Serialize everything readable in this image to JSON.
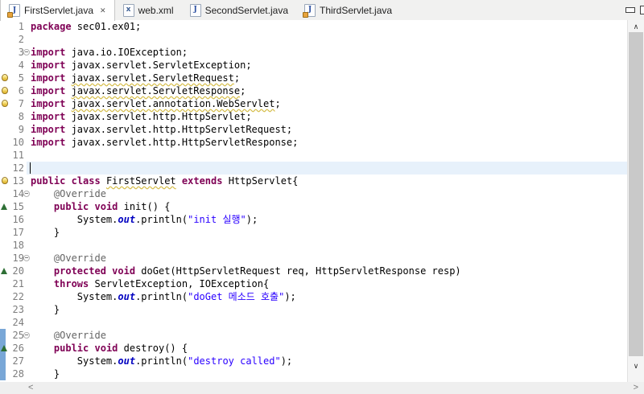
{
  "tabs": [
    {
      "label": "FirstServlet.java",
      "type": "java",
      "icon_letter": "J",
      "active": true,
      "closable": true,
      "warning_decorator": true
    },
    {
      "label": "web.xml",
      "type": "xml",
      "icon_letter": "x",
      "active": false,
      "closable": false,
      "warning_decorator": false
    },
    {
      "label": "SecondServlet.java",
      "type": "java",
      "icon_letter": "J",
      "active": false,
      "closable": false,
      "warning_decorator": false
    },
    {
      "label": "ThirdServlet.java",
      "type": "java",
      "icon_letter": "J",
      "active": false,
      "closable": false,
      "warning_decorator": true
    }
  ],
  "window_controls": [
    "minimize",
    "maximize"
  ],
  "icons": {
    "close": "✕",
    "scroll_up": "∧",
    "scroll_down": "∨",
    "scroll_left": "<",
    "scroll_right": ">"
  },
  "colors": {
    "keyword": "#7f0055",
    "string": "#2a00ff",
    "static_field": "#0000c0",
    "annotation": "#646464",
    "line_number": "#7d7d7d",
    "cursor_line_bg": "#e7f1fb",
    "diff_change_bar": "#79a7d7",
    "override_indicator": "#2e6f35",
    "warning_underline": "#d6be4b",
    "tab_bar_bg": "#f1f1f0",
    "active_tab_bg": "#ffffff"
  },
  "editor": {
    "lines": [
      {
        "num": 1,
        "tokens": [
          {
            "t": "package",
            "c": "kw"
          },
          {
            "t": " sec01.ex01;",
            "c": "pl"
          }
        ]
      },
      {
        "num": 2,
        "tokens": []
      },
      {
        "num": 3,
        "fold": true,
        "tokens": [
          {
            "t": "import",
            "c": "kw"
          },
          {
            "t": " java.io.IOException;",
            "c": "pl"
          }
        ]
      },
      {
        "num": 4,
        "tokens": [
          {
            "t": "import",
            "c": "kw"
          },
          {
            "t": " javax.servlet.ServletException;",
            "c": "pl"
          }
        ]
      },
      {
        "num": 5,
        "warn": true,
        "tokens": [
          {
            "t": "import",
            "c": "kw"
          },
          {
            "t": " ",
            "c": "pl"
          },
          {
            "t": "javax.servlet.ServletRequest",
            "c": "pl wv"
          },
          {
            "t": ";",
            "c": "pl"
          }
        ]
      },
      {
        "num": 6,
        "warn": true,
        "tokens": [
          {
            "t": "import",
            "c": "kw"
          },
          {
            "t": " ",
            "c": "pl"
          },
          {
            "t": "javax.servlet.ServletResponse",
            "c": "pl wv"
          },
          {
            "t": ";",
            "c": "pl"
          }
        ]
      },
      {
        "num": 7,
        "warn": true,
        "tokens": [
          {
            "t": "import",
            "c": "kw"
          },
          {
            "t": " ",
            "c": "pl"
          },
          {
            "t": "javax.servlet.annotation.WebServlet",
            "c": "pl wv"
          },
          {
            "t": ";",
            "c": "pl"
          }
        ]
      },
      {
        "num": 8,
        "tokens": [
          {
            "t": "import",
            "c": "kw"
          },
          {
            "t": " javax.servlet.http.HttpServlet;",
            "c": "pl"
          }
        ]
      },
      {
        "num": 9,
        "tokens": [
          {
            "t": "import",
            "c": "kw"
          },
          {
            "t": " javax.servlet.http.HttpServletRequest;",
            "c": "pl"
          }
        ]
      },
      {
        "num": 10,
        "tokens": [
          {
            "t": "import",
            "c": "kw"
          },
          {
            "t": " javax.servlet.http.HttpServletResponse;",
            "c": "pl"
          }
        ]
      },
      {
        "num": 11,
        "tokens": []
      },
      {
        "num": 12,
        "cursor": true,
        "tokens": []
      },
      {
        "num": 13,
        "warn": true,
        "tokens": [
          {
            "t": "public",
            "c": "kw"
          },
          {
            "t": " ",
            "c": "pl"
          },
          {
            "t": "class",
            "c": "kw"
          },
          {
            "t": " ",
            "c": "pl"
          },
          {
            "t": "FirstServlet",
            "c": "pl wv"
          },
          {
            "t": " ",
            "c": "pl"
          },
          {
            "t": "extends",
            "c": "kw"
          },
          {
            "t": " HttpServlet{",
            "c": "pl"
          }
        ]
      },
      {
        "num": 14,
        "fold": true,
        "tokens": [
          {
            "t": "    ",
            "c": "pl"
          },
          {
            "t": "@Override",
            "c": "an"
          }
        ]
      },
      {
        "num": 15,
        "tri": true,
        "tokens": [
          {
            "t": "    ",
            "c": "pl"
          },
          {
            "t": "public",
            "c": "kw"
          },
          {
            "t": " ",
            "c": "pl"
          },
          {
            "t": "void",
            "c": "kw"
          },
          {
            "t": " init() {",
            "c": "pl"
          }
        ]
      },
      {
        "num": 16,
        "tokens": [
          {
            "t": "        System.",
            "c": "pl"
          },
          {
            "t": "out",
            "c": "st"
          },
          {
            "t": ".println(",
            "c": "pl"
          },
          {
            "t": "\"init 실행\"",
            "c": "str"
          },
          {
            "t": ");",
            "c": "pl"
          }
        ]
      },
      {
        "num": 17,
        "tokens": [
          {
            "t": "    }",
            "c": "pl"
          }
        ]
      },
      {
        "num": 18,
        "tokens": []
      },
      {
        "num": 19,
        "fold": true,
        "tokens": [
          {
            "t": "    ",
            "c": "pl"
          },
          {
            "t": "@Override",
            "c": "an"
          }
        ]
      },
      {
        "num": 20,
        "tri": true,
        "tokens": [
          {
            "t": "    ",
            "c": "pl"
          },
          {
            "t": "protected",
            "c": "kw"
          },
          {
            "t": " ",
            "c": "pl"
          },
          {
            "t": "void",
            "c": "kw"
          },
          {
            "t": " doGet(HttpServletRequest req, HttpServletResponse resp)",
            "c": "pl"
          }
        ]
      },
      {
        "num": 21,
        "tokens": [
          {
            "t": "    ",
            "c": "pl"
          },
          {
            "t": "throws",
            "c": "kw"
          },
          {
            "t": " ServletException, IOException{",
            "c": "pl"
          }
        ]
      },
      {
        "num": 22,
        "tokens": [
          {
            "t": "        System.",
            "c": "pl"
          },
          {
            "t": "out",
            "c": "st"
          },
          {
            "t": ".println(",
            "c": "pl"
          },
          {
            "t": "\"doGet 메소드 호출\"",
            "c": "str"
          },
          {
            "t": ");",
            "c": "pl"
          }
        ]
      },
      {
        "num": 23,
        "tokens": [
          {
            "t": "    }",
            "c": "pl"
          }
        ]
      },
      {
        "num": 24,
        "tokens": []
      },
      {
        "num": 25,
        "fold": true,
        "diff": true,
        "tokens": [
          {
            "t": "    ",
            "c": "pl"
          },
          {
            "t": "@Override",
            "c": "an"
          }
        ]
      },
      {
        "num": 26,
        "tri": true,
        "diff": true,
        "tokens": [
          {
            "t": "    ",
            "c": "pl"
          },
          {
            "t": "public",
            "c": "kw"
          },
          {
            "t": " ",
            "c": "pl"
          },
          {
            "t": "void",
            "c": "kw"
          },
          {
            "t": " destroy() {",
            "c": "pl"
          }
        ]
      },
      {
        "num": 27,
        "diff": true,
        "tokens": [
          {
            "t": "        System.",
            "c": "pl"
          },
          {
            "t": "out",
            "c": "st"
          },
          {
            "t": ".println(",
            "c": "pl"
          },
          {
            "t": "\"destroy called\"",
            "c": "str"
          },
          {
            "t": ");",
            "c": "pl"
          }
        ]
      },
      {
        "num": 28,
        "diff": true,
        "tokens": [
          {
            "t": "    }",
            "c": "pl"
          }
        ]
      }
    ]
  }
}
